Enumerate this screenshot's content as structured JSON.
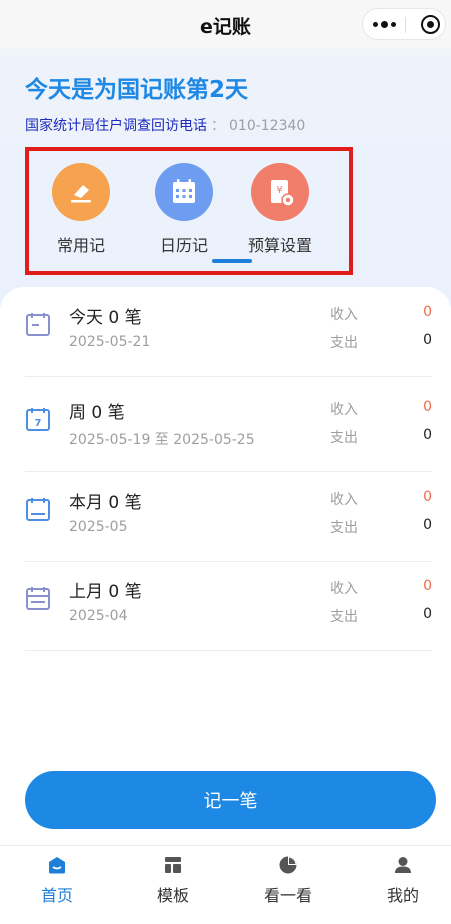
{
  "header": {
    "title": "e记账"
  },
  "headline": "今天是为国记账第2天",
  "hotline": {
    "label": "国家统计局住户调查回访电话",
    "separator": "：",
    "number": "010-12340"
  },
  "quick_actions": [
    {
      "label": "常用记",
      "icon": "eraser-icon",
      "color": "#f7a24f"
    },
    {
      "label": "日历记",
      "icon": "calendar-icon",
      "color": "#6d9cf0"
    },
    {
      "label": "预算设置",
      "icon": "budget-icon",
      "color": "#f07e6a"
    }
  ],
  "ledger": [
    {
      "title": "今天 0 笔",
      "date": "2025-05-21",
      "income_label": "收入",
      "income": "0",
      "expense_label": "支出",
      "expense": "0",
      "icon": "day-calendar-icon"
    },
    {
      "title": "周 0 笔",
      "date": "2025-05-19 至 2025-05-25",
      "income_label": "收入",
      "income": "0",
      "expense_label": "支出",
      "expense": "0",
      "icon": "week-calendar-icon",
      "icon_text": "7"
    },
    {
      "title": "本月 0 笔",
      "date": "2025-05",
      "income_label": "收入",
      "income": "0",
      "expense_label": "支出",
      "expense": "0",
      "icon": "month-calendar-icon"
    },
    {
      "title": "上月 0 笔",
      "date": "2025-04",
      "income_label": "收入",
      "income": "0",
      "expense_label": "支出",
      "expense": "0",
      "icon": "last-month-calendar-icon"
    }
  ],
  "record_button": "记一笔",
  "tabs": [
    {
      "label": "首页",
      "icon": "home-icon",
      "active": true
    },
    {
      "label": "模板",
      "icon": "template-icon"
    },
    {
      "label": "看一看",
      "icon": "pie-chart-icon"
    },
    {
      "label": "我的",
      "icon": "user-icon"
    }
  ],
  "colors": {
    "primary": "#1e88e5",
    "income": "#ec6c4b",
    "highlight_box": "#e21b1b",
    "hotline_label": "#1d2bbf"
  }
}
